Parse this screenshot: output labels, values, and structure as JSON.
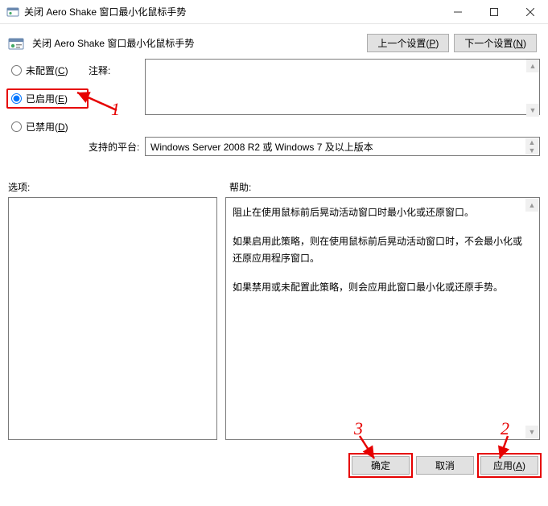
{
  "window": {
    "title": "关闭 Aero Shake 窗口最小化鼠标手势"
  },
  "header": {
    "heading": "关闭 Aero Shake 窗口最小化鼠标手势",
    "nav": {
      "prev_pre": "上一个设置(",
      "prev_u": "P",
      "prev_post": ")",
      "next_pre": "下一个设置(",
      "next_u": "N",
      "next_post": ")"
    }
  },
  "radios": {
    "notconf_pre": "未配置(",
    "notconf_u": "C",
    "notconf_post": ")",
    "enabled_pre": "已启用(",
    "enabled_u": "E",
    "enabled_post": ")",
    "disabled_pre": "已禁用(",
    "disabled_u": "D",
    "disabled_post": ")",
    "selected": "enabled"
  },
  "labels": {
    "comment": "注释:",
    "platform": "支持的平台:",
    "options": "选项:",
    "help": "帮助:"
  },
  "platform_text": "Windows Server 2008 R2 或 Windows 7 及以上版本",
  "help_text": {
    "p1": "阻止在使用鼠标前后晃动活动窗口时最小化或还原窗口。",
    "p2": "如果启用此策略，则在使用鼠标前后晃动活动窗口时，不会最小化或还原应用程序窗口。",
    "p3": "如果禁用或未配置此策略，则会应用此窗口最小化或还原手势。"
  },
  "footer": {
    "ok": "确定",
    "cancel": "取消",
    "apply_pre": "应用(",
    "apply_u": "A",
    "apply_post": ")"
  },
  "annotations": {
    "n1": "1",
    "n2": "2",
    "n3": "3"
  }
}
